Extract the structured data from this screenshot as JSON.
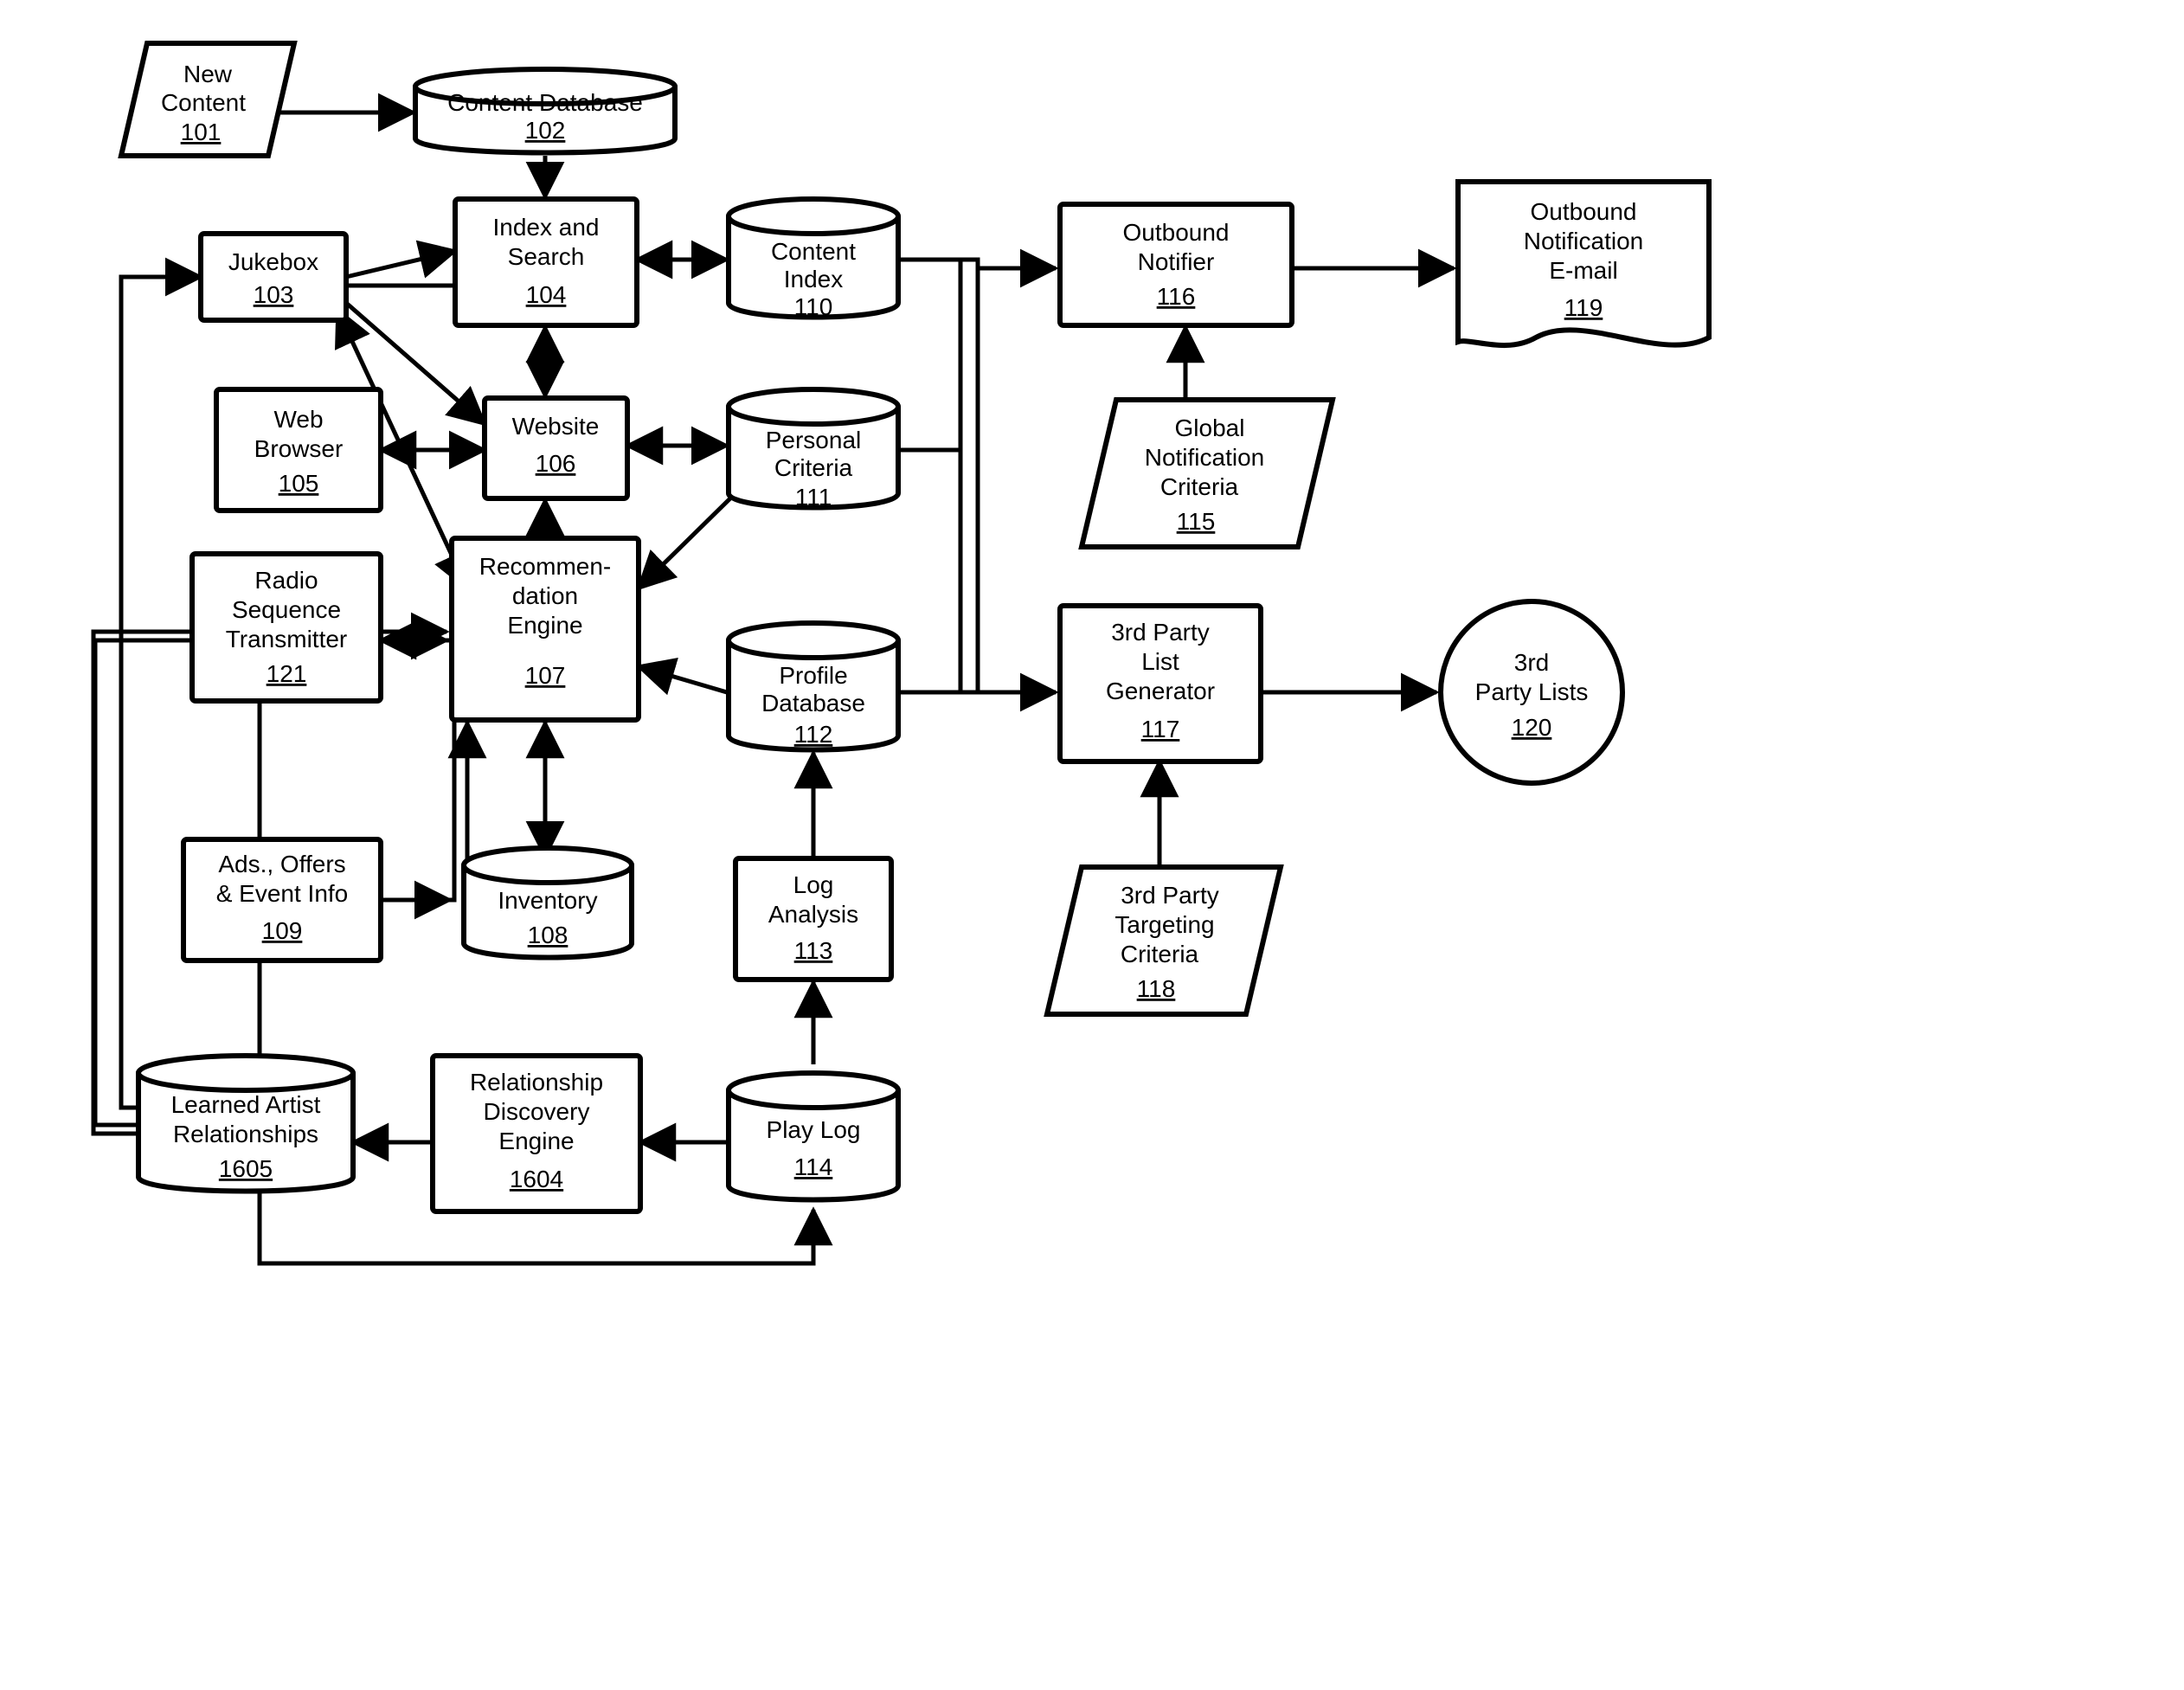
{
  "nodes": {
    "n101": {
      "label": "New Content",
      "ref": "101"
    },
    "n102": {
      "label": "Content Database",
      "ref": "102"
    },
    "n103": {
      "label": "Jukebox",
      "ref": "103"
    },
    "n104": {
      "label": "Index and Search",
      "ref": "104"
    },
    "n105": {
      "label": "Web Browser",
      "ref": "105"
    },
    "n106": {
      "label": "Website",
      "ref": "106"
    },
    "n107": {
      "label": "Recommen-dation Engine",
      "ref": "107"
    },
    "n108": {
      "label": "Inventory",
      "ref": "108"
    },
    "n109": {
      "label": "Ads., Offers & Event Info",
      "ref": "109"
    },
    "n110": {
      "label": "Content Index",
      "ref": "110"
    },
    "n111": {
      "label": "Personal Criteria",
      "ref": "111"
    },
    "n112": {
      "label": "Profile Database",
      "ref": "112"
    },
    "n113": {
      "label": "Log Analysis",
      "ref": "113"
    },
    "n114": {
      "label": "Play Log",
      "ref": "114"
    },
    "n115": {
      "label": "Global Notification Criteria",
      "ref": "115"
    },
    "n116": {
      "label": "Outbound Notifier",
      "ref": "116"
    },
    "n117": {
      "label": "3rd Party List Generator",
      "ref": "117"
    },
    "n118": {
      "label": "3rd Party Targeting Criteria",
      "ref": "118"
    },
    "n119": {
      "label": "Outbound Notification E-mail",
      "ref": "119"
    },
    "n120": {
      "label": "3rd Party Lists",
      "ref": "120"
    },
    "n121": {
      "label": "Radio Sequence Transmitter",
      "ref": "121"
    },
    "n1604": {
      "label": "Relationship Discovery Engine",
      "ref": "1604"
    },
    "n1605": {
      "label": "Learned Artist Relationships",
      "ref": "1605"
    }
  },
  "edges": [
    "101→102",
    "102→104",
    "104↔110",
    "104↔106",
    "106↔105",
    "106↔111",
    "106→107",
    "107↔103",
    "107→121",
    "109→107",
    "108↔107",
    "111→107",
    "112→107",
    "113→112",
    "114→113",
    "110→116",
    "111→116",
    "112→116",
    "115→116",
    "116→119",
    "110→117",
    "111→117",
    "112→117",
    "118→117",
    "117→120",
    "114→1604",
    "1604→1605",
    "1605→107",
    "1605→103",
    "121→114",
    "103→104",
    "103→106"
  ]
}
